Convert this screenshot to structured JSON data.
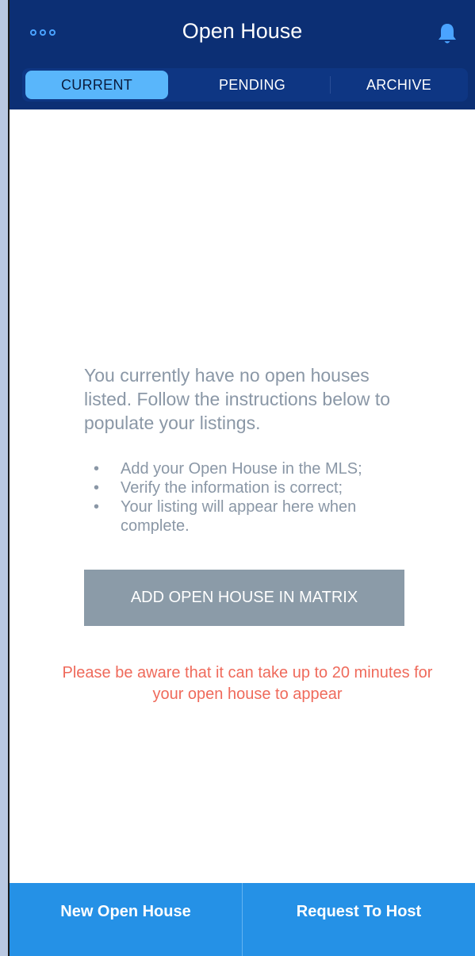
{
  "header": {
    "title": "Open House",
    "more_icon": "more-dots-icon",
    "bell_icon": "bell-icon",
    "accent_color": "#4aa3ff"
  },
  "tabs": [
    {
      "label": "CURRENT",
      "active": true
    },
    {
      "label": "PENDING",
      "active": false
    },
    {
      "label": "ARCHIVE",
      "active": false
    }
  ],
  "empty_state": {
    "message": "You currently have no open houses listed. Follow the instructions below to populate your listings.",
    "instructions": [
      "Add your Open House in the MLS;",
      "Verify the information is correct;",
      "Your listing will appear here when complete."
    ],
    "bullet": "•",
    "action_label": "ADD OPEN HOUSE IN MATRIX",
    "warning": "Please be aware that it can take up to 20 minutes for your open house to appear",
    "warning_color": "#ef6a5b"
  },
  "bottom_bar": {
    "new_label": "New Open House",
    "host_label": "Request To Host",
    "color": "#2591e6"
  }
}
